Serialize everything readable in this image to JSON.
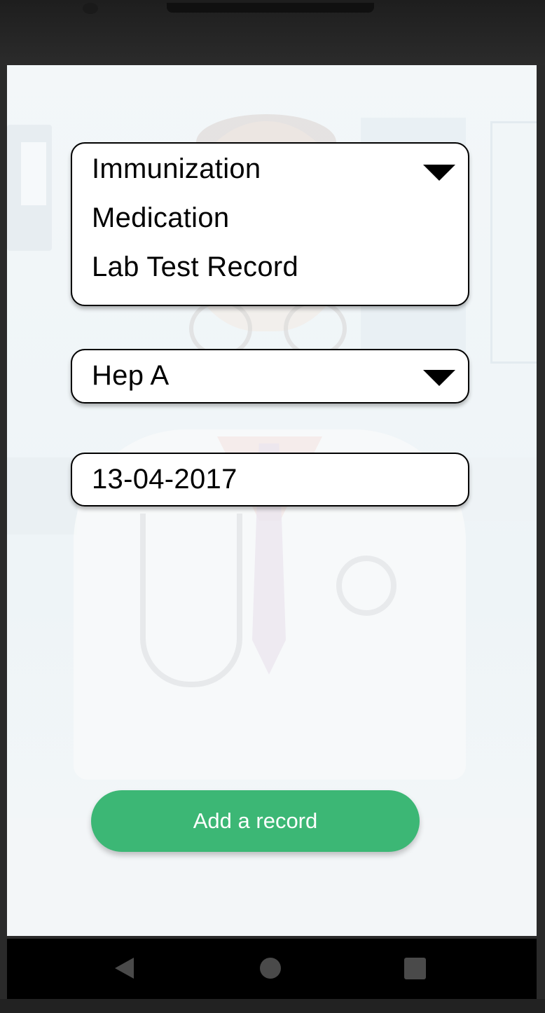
{
  "record_type_dropdown": {
    "options": [
      "Immunization",
      "Medication",
      "Lab Test Record"
    ],
    "selected": "Immunization",
    "icon": "caret-down-icon"
  },
  "vaccine_dropdown": {
    "selected": "Hep A",
    "icon": "caret-down-icon"
  },
  "date_field": {
    "value": "13-04-2017"
  },
  "add_button": {
    "label": "Add a record"
  },
  "nav": {
    "back_icon": "back-triangle-icon",
    "home_icon": "home-circle-icon",
    "recents_icon": "recents-square-icon"
  },
  "colors": {
    "accent": "#3cb775",
    "screen_background": "#f3f7f9",
    "bezel": "#2a2a2a"
  }
}
